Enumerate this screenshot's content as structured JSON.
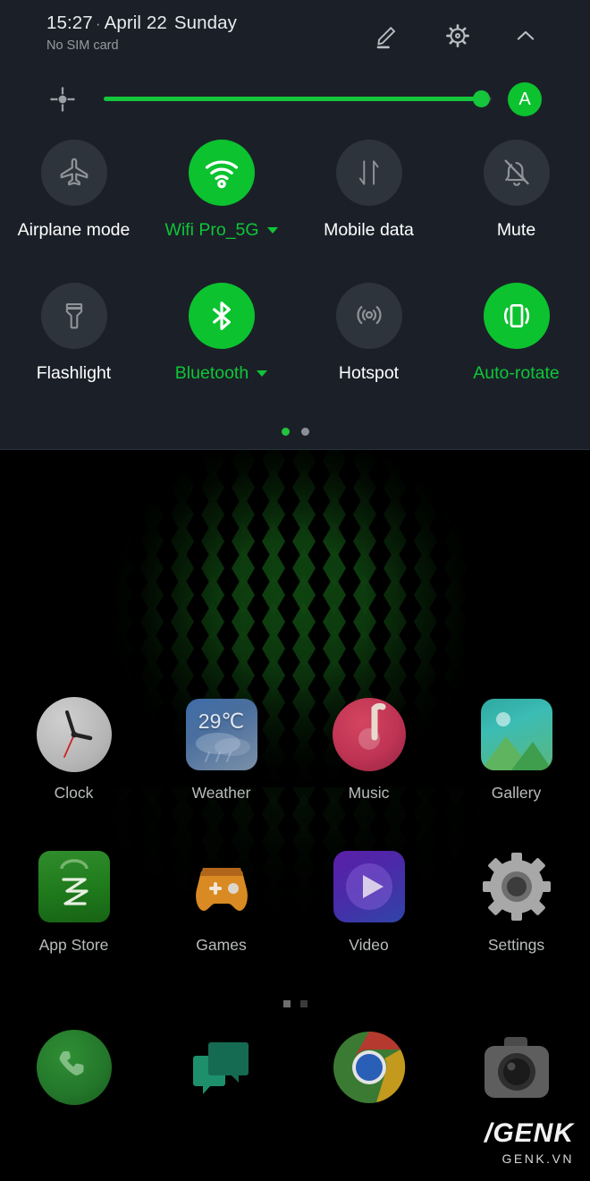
{
  "statusbar": {
    "time": "15:27",
    "separator": "·",
    "date": "April 22",
    "weekday": "Sunday",
    "sim_status": "No SIM card",
    "edit_icon": "pencil-icon",
    "settings_icon": "gear-icon",
    "collapse_icon": "chevron-up-icon"
  },
  "brightness": {
    "icon": "brightness-icon",
    "value_percent": 95,
    "auto_label": "A",
    "accent": "#0cc22f"
  },
  "quick_settings": {
    "tiles": [
      {
        "label": "Airplane mode",
        "icon": "airplane-icon",
        "state": "off",
        "has_caret": false
      },
      {
        "label": "Wifi Pro_5G",
        "icon": "wifi-icon",
        "state": "on",
        "has_caret": true
      },
      {
        "label": "Mobile data",
        "icon": "mobile-data-icon",
        "state": "off",
        "has_caret": false
      },
      {
        "label": "Mute",
        "icon": "bell-off-icon",
        "state": "off",
        "has_caret": false
      },
      {
        "label": "Flashlight",
        "icon": "flashlight-icon",
        "state": "off",
        "has_caret": false
      },
      {
        "label": "Bluetooth",
        "icon": "bluetooth-icon",
        "state": "on",
        "has_caret": true
      },
      {
        "label": "Hotspot",
        "icon": "hotspot-icon",
        "state": "off",
        "has_caret": false
      },
      {
        "label": "Auto-rotate",
        "icon": "auto-rotate-icon",
        "state": "on",
        "has_caret": false
      }
    ],
    "page_dots": {
      "count": 2,
      "active_index": 0
    }
  },
  "home": {
    "rows": [
      [
        {
          "label": "Clock",
          "icon": "clock-icon"
        },
        {
          "label": "Weather",
          "icon": "weather-icon",
          "badge": "29℃"
        },
        {
          "label": "Music",
          "icon": "music-icon"
        },
        {
          "label": "Gallery",
          "icon": "gallery-icon"
        }
      ],
      [
        {
          "label": "App Store",
          "icon": "app-store-icon"
        },
        {
          "label": "Games",
          "icon": "games-icon"
        },
        {
          "label": "Video",
          "icon": "video-icon"
        },
        {
          "label": "Settings",
          "icon": "settings-icon"
        }
      ]
    ],
    "dock": [
      {
        "label": "",
        "icon": "phone-icon"
      },
      {
        "label": "",
        "icon": "messages-icon"
      },
      {
        "label": "",
        "icon": "chrome-icon"
      },
      {
        "label": "",
        "icon": "camera-icon"
      }
    ],
    "page_dots": {
      "count": 2,
      "active_index": 0
    }
  },
  "watermark": {
    "main": "/GENK",
    "sub": "GENK.VN"
  },
  "colors": {
    "panel_background": "#1b2028",
    "tile_off": "#2e343c",
    "accent_green": "#0cc22f",
    "label_white": "#ffffff",
    "label_muted": "#969b9f"
  }
}
